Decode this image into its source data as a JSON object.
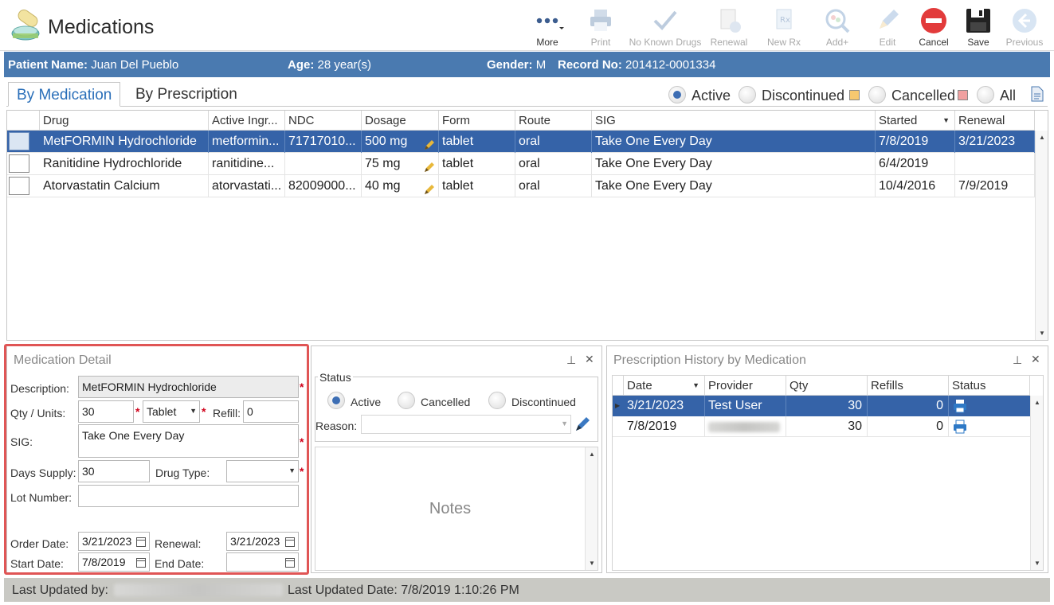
{
  "app": {
    "title": "Medications"
  },
  "toolbar": {
    "buttons": [
      {
        "label": "More",
        "icon": "more-icon",
        "enabled": true
      },
      {
        "label": "Print",
        "icon": "printer-icon",
        "enabled": false
      },
      {
        "label": "No Known Drugs",
        "icon": "checkmark-icon",
        "enabled": false
      },
      {
        "label": "Renewal",
        "icon": "renewal-icon",
        "enabled": false
      },
      {
        "label": "New Rx",
        "icon": "new-rx-icon",
        "enabled": false
      },
      {
        "label": "Add+",
        "icon": "add-pills-icon",
        "enabled": false
      },
      {
        "label": "Edit",
        "icon": "pencil-icon",
        "enabled": false
      },
      {
        "label": "Cancel",
        "icon": "cancel-icon",
        "enabled": true
      },
      {
        "label": "Save",
        "icon": "save-icon",
        "enabled": true
      },
      {
        "label": "Previous",
        "icon": "previous-arrow-icon",
        "enabled": false
      }
    ]
  },
  "patient": {
    "name_label": "Patient Name:",
    "name": "Juan Del Pueblo",
    "age_label": "Age:",
    "age": "28 year(s)",
    "gender_label": "Gender:",
    "gender": "M",
    "record_label": "Record No:",
    "record": "201412-0001334"
  },
  "tabs": {
    "by_medication": "By Medication",
    "by_prescription": "By Prescription"
  },
  "filters": {
    "active": "Active",
    "discontinued": "Discontinued",
    "cancelled": "Cancelled",
    "all": "All",
    "selected": "Active",
    "discontinued_color": "#f7c86f",
    "cancelled_color": "#f0a0a0"
  },
  "grid": {
    "columns": [
      "Drug",
      "Active Ingr...",
      "NDC",
      "Dosage",
      "Form",
      "Route",
      "SIG",
      "Started",
      "Renewal"
    ],
    "rows": [
      {
        "drug": "MetFORMIN Hydrochloride",
        "ingredient": "metformin...",
        "ndc": "71717010...",
        "dosage": "500 mg",
        "form": "tablet",
        "route": "oral",
        "sig": "Take One Every Day",
        "started": "7/8/2019",
        "renewal": "3/21/2023",
        "selected": true
      },
      {
        "drug": "Ranitidine Hydrochloride",
        "ingredient": "ranitidine...",
        "ndc": "",
        "dosage": "75 mg",
        "form": "tablet",
        "route": "oral",
        "sig": "Take One Every Day",
        "started": "6/4/2019",
        "renewal": "",
        "selected": false
      },
      {
        "drug": "Atorvastatin Calcium",
        "ingredient": "atorvastati...",
        "ndc": "82009000...",
        "dosage": "40 mg",
        "form": "tablet",
        "route": "oral",
        "sig": "Take One Every Day",
        "started": "10/4/2016",
        "renewal": "7/9/2019",
        "selected": false
      }
    ]
  },
  "detail": {
    "title": "Medication Detail",
    "description_label": "Description:",
    "description": "MetFORMIN Hydrochloride",
    "qty_label": "Qty / Units:",
    "qty": "30",
    "units": "Tablet",
    "refill_label": "Refill:",
    "refill": "0",
    "sig_label": "SIG:",
    "sig": "Take One Every Day",
    "days_supply_label": "Days Supply:",
    "days_supply": "30",
    "drug_type_label": "Drug Type:",
    "drug_type": "",
    "lot_label": "Lot Number:",
    "lot": "",
    "order_date_label": "Order Date:",
    "order_date": "3/21/2023",
    "renewal_label": "Renewal:",
    "renewal": "3/21/2023",
    "start_date_label": "Start Date:",
    "start_date": "7/8/2019",
    "end_date_label": "End Date:",
    "end_date": "",
    "required_mark": "*"
  },
  "status_panel": {
    "title": "Status",
    "active": "Active",
    "cancelled": "Cancelled",
    "discontinued": "Discontinued",
    "selected": "Active",
    "reason_label": "Reason:",
    "reason": "",
    "notes_placeholder": "Notes"
  },
  "history": {
    "title": "Prescription History by Medication",
    "columns": [
      "Date",
      "Provider",
      "Qty",
      "Refills",
      "Status"
    ],
    "rows": [
      {
        "date": "3/21/2023",
        "provider": "Test User",
        "qty": "30",
        "refills": "0",
        "status_icon": "printer-icon",
        "selected": true
      },
      {
        "date": "7/8/2019",
        "provider": "",
        "qty": "30",
        "refills": "0",
        "status_icon": "printer-icon",
        "selected": false
      }
    ]
  },
  "statusbar": {
    "last_updated_by_label": "Last Updated by:",
    "last_updated_by": "",
    "last_updated_date_label": "Last Updated Date:",
    "last_updated_date": "7/8/2019 1:10:26 PM"
  },
  "panel_controls": {
    "pin": "📌",
    "close": "✕"
  }
}
